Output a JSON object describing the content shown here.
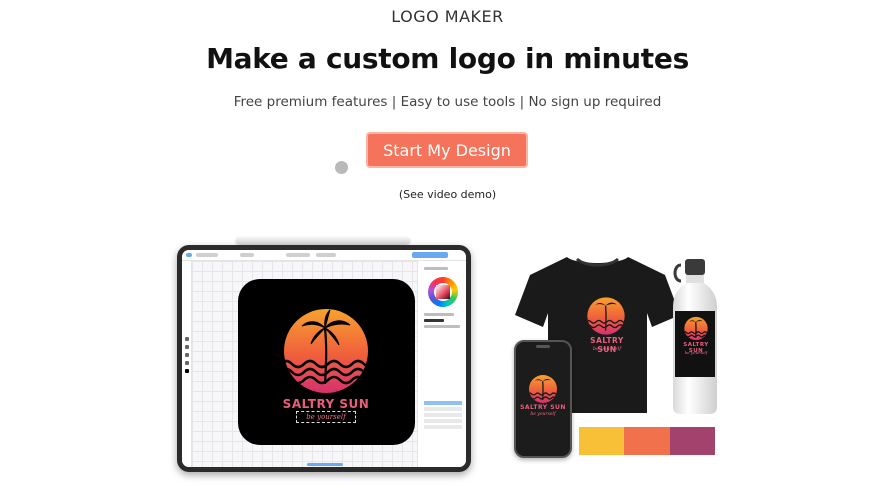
{
  "hero": {
    "eyebrow": "LOGO MAKER",
    "headline": "Make a custom logo in minutes",
    "subline": "Free premium features | Easy to use tools | No sign up required",
    "cta_label": "Start My Design",
    "demo_link": "(See video demo)"
  },
  "logo": {
    "brand": "SALTRY SUN",
    "tagline": "be yourself"
  },
  "colors": {
    "accent": "#f5735a",
    "palette": [
      "#f8c036",
      "#f0714b",
      "#a2426d"
    ]
  },
  "icons": {
    "tablet_color_picker": "color-wheel-icon",
    "palm": "palm-tree-icon"
  }
}
